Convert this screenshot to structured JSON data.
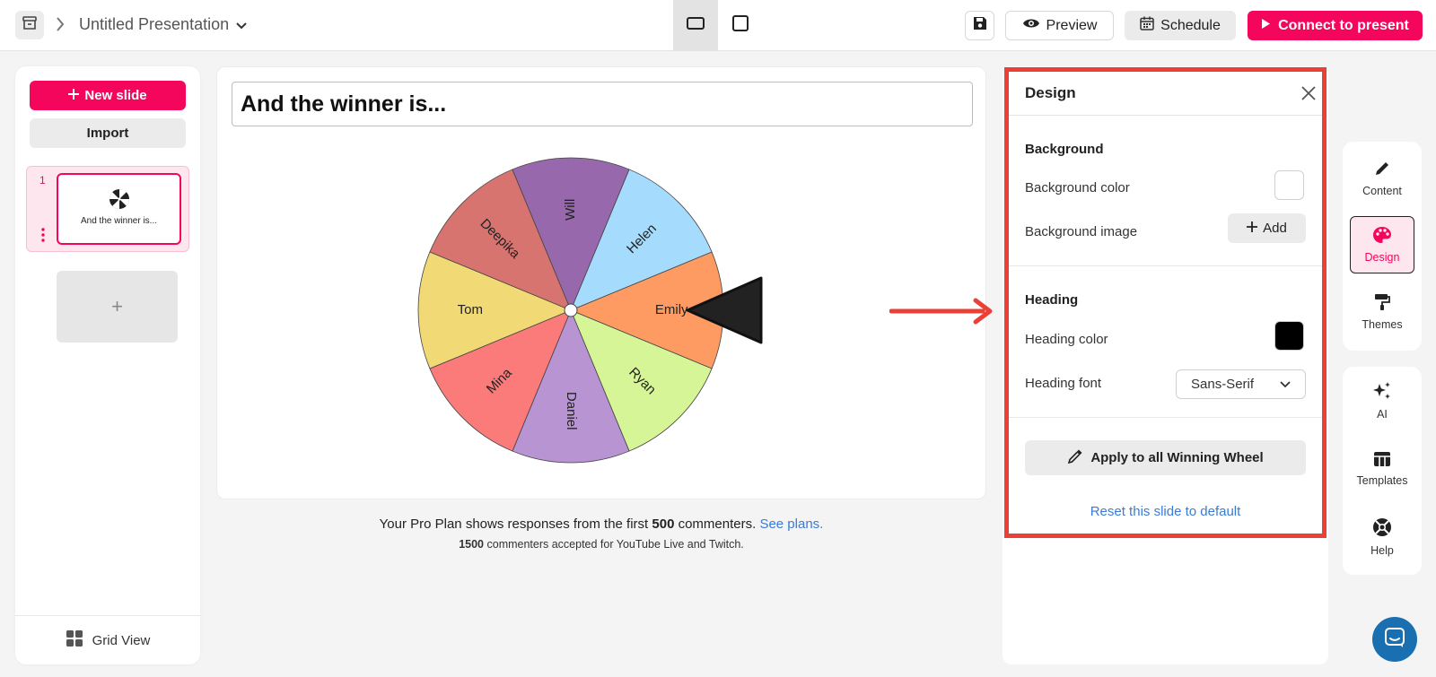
{
  "topbar": {
    "presentation_title": "Untitled Presentation",
    "preview_label": "Preview",
    "schedule_label": "Schedule",
    "connect_label": "Connect to present"
  },
  "left_panel": {
    "new_slide_label": "New slide",
    "import_label": "Import",
    "slides": [
      {
        "number": "1",
        "title": "And the winner is..."
      }
    ],
    "add_slide_symbol": "+",
    "grid_view_label": "Grid View"
  },
  "canvas": {
    "heading": "And the winner is...",
    "wheel_segments": [
      {
        "name": "Emily",
        "color": "#fd9b62"
      },
      {
        "name": "Ryan",
        "color": "#d6f597"
      },
      {
        "name": "Daniel",
        "color": "#b894d2"
      },
      {
        "name": "Mina",
        "color": "#fb7b7b"
      },
      {
        "name": "Tom",
        "color": "#f1d975"
      },
      {
        "name": "Deepika",
        "color": "#d77470"
      },
      {
        "name": "Will",
        "color": "#9769ac"
      },
      {
        "name": "Helen",
        "color": "#a5dcfd"
      }
    ]
  },
  "plan_notice": {
    "line1_prefix": "Your Pro Plan shows responses from the first ",
    "line1_count": "500",
    "line1_suffix": " commenters.",
    "line1_link": "See plans.",
    "line2_count": "1500",
    "line2_text": " commenters accepted for YouTube Live and Twitch."
  },
  "design_panel": {
    "title": "Design",
    "background_section": "Background",
    "background_color_label": "Background color",
    "background_color_value": "#ffffff",
    "background_image_label": "Background image",
    "add_label": "Add",
    "heading_section": "Heading",
    "heading_color_label": "Heading color",
    "heading_color_value": "#000000",
    "heading_font_label": "Heading font",
    "heading_font_value": "Sans-Serif",
    "apply_label": "Apply to all Winning Wheel",
    "reset_label": "Reset this slide to default"
  },
  "right_toolbar": {
    "content_label": "Content",
    "design_label": "Design",
    "themes_label": "Themes",
    "ai_label": "AI",
    "templates_label": "Templates",
    "help_label": "Help"
  },
  "colors": {
    "brand_pink": "#f5065d",
    "highlight_red": "#ea4036",
    "link_blue": "#3a7bd5"
  }
}
